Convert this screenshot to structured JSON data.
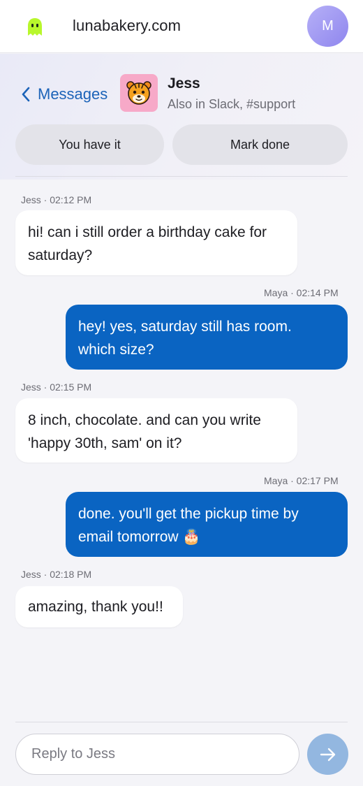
{
  "topbar": {
    "site": "lunabakery.com",
    "avatar_initial": "M",
    "logo_icon": "ghost-icon",
    "accent": "#b6b0f7"
  },
  "header": {
    "back_label": "Messages",
    "contact_name": "Jess",
    "contact_subtitle": "Also in Slack, #support",
    "contact_avatar_icon": "tiger-face-icon",
    "actions": {
      "you_have_it": "You have it",
      "mark_done": "Mark done"
    }
  },
  "messages": [
    {
      "sender": "Jess",
      "meta": "Jess · 02:12 PM",
      "line1": "hi! can i still order a birthday cake for",
      "line2": "saturday?"
    },
    {
      "sender": "Maya",
      "meta": "Maya · 02:14 PM",
      "line1": "hey! yes, saturday still has room.",
      "line2": "which size?"
    },
    {
      "sender": "Jess",
      "meta": "Jess · 02:15 PM",
      "line1": "8 inch, chocolate. and can you write",
      "line2": "'happy 30th, sam' on it?"
    },
    {
      "sender": "Maya",
      "meta": "Maya · 02:17 PM",
      "line1": "done. you'll get the pickup time by",
      "line2": "email tomorrow 🎂"
    },
    {
      "sender": "Jess",
      "meta": "Jess · 02:18 PM",
      "line1": "amazing, thank you!!"
    }
  ],
  "composer": {
    "placeholder": "Reply to Jess",
    "value": "",
    "send_icon": "arrow-right-icon"
  },
  "colors": {
    "outgoing_bubble": "#0a64c2",
    "incoming_bubble": "#ffffff",
    "link": "#1c63b8",
    "send_button": "#93b7e0"
  }
}
